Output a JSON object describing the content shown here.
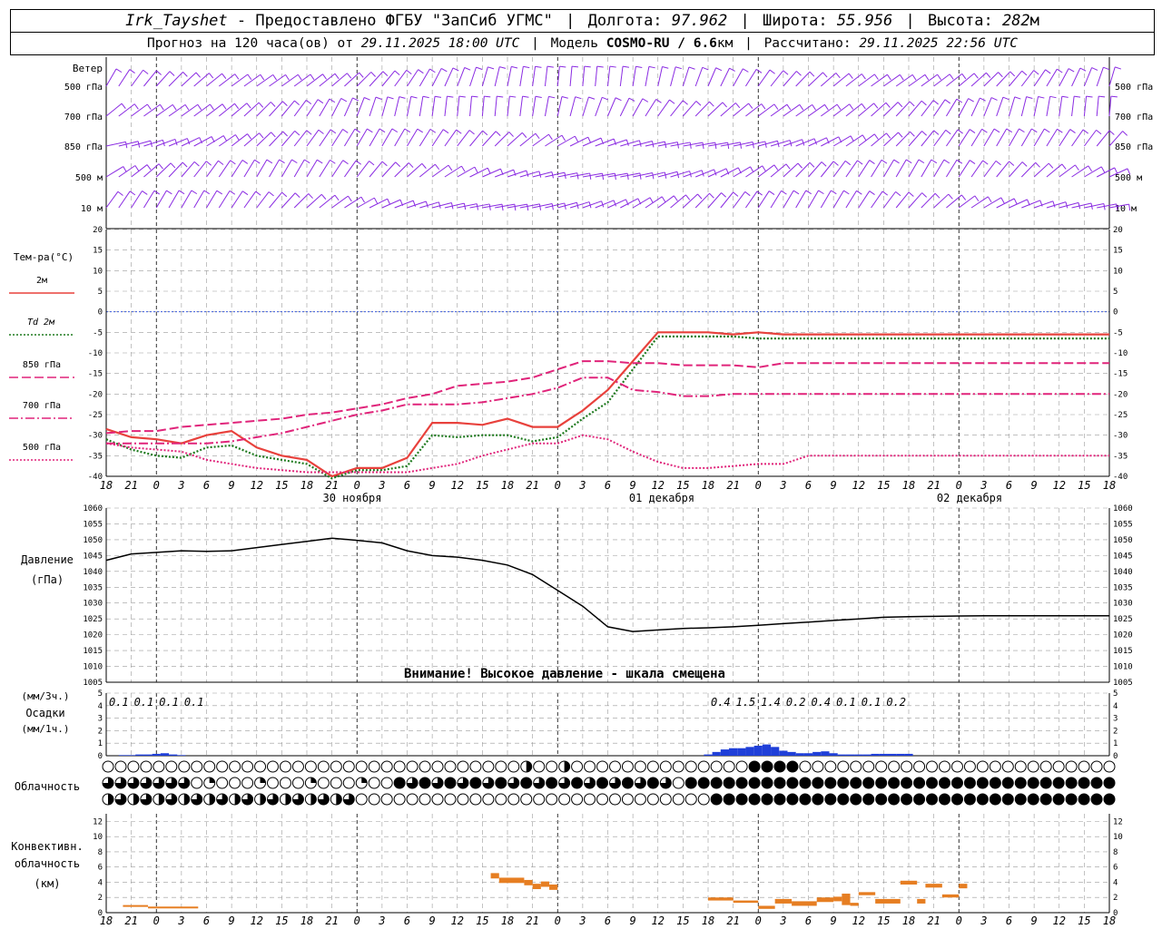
{
  "header": {
    "station": "Irk_Tayshet",
    "provider": "Предоставлено ФГБУ \"ЗапСиб УГМС\"",
    "lon_label": "Долгота:",
    "lon": "97.962",
    "lat_label": "Широта:",
    "lat": "55.956",
    "alt_label": "Высота:",
    "alt": "282",
    "alt_unit": "м",
    "forecast_label": "Прогноз на 120 часа(ов) от",
    "forecast_from": "29.11.2025 18:00 UTC",
    "model_label": "Модель",
    "model": "COSMO-RU / 6.6",
    "model_unit": "км",
    "calc_label": "Рассчитано:",
    "calc_time": "29.11.2025 22:56 UTC"
  },
  "colors": {
    "wind": "#8a2be2",
    "t2m": "#e8413c",
    "td2m": "#1e7a1e",
    "upper": "#e0247a",
    "pressure": "#000000",
    "precip": "#1f3fd8",
    "conv": "#e67e22",
    "zero_line": "#3b5bdb",
    "grid": "#9a9a9a"
  },
  "chart_data": [
    {
      "type": "wind_barbs",
      "panel_title": "Ветер",
      "levels": [
        "500 гПа",
        "700 гПа",
        "850 гПа",
        "500 м",
        "10 м"
      ]
    },
    {
      "type": "line",
      "panel_title": "Тем-ра(°C)",
      "ylim": [
        -40,
        20
      ],
      "yticks": [
        20,
        15,
        10,
        5,
        0,
        -5,
        -10,
        -15,
        -20,
        -25,
        -30,
        -35,
        -40
      ],
      "x_hours": [
        0,
        3,
        6,
        9,
        12,
        15,
        18,
        21,
        24,
        27,
        30,
        33,
        36,
        39,
        42,
        45,
        48,
        51,
        54,
        57,
        60,
        63,
        66,
        69,
        72,
        75,
        78,
        81,
        84,
        87,
        90,
        93,
        96,
        99,
        102,
        105,
        108,
        111,
        114,
        117,
        120
      ],
      "x_tick_labels": [
        "18",
        "21",
        "0",
        "3",
        "6",
        "9",
        "12",
        "15",
        "18",
        "21",
        "0",
        "3",
        "6",
        "9",
        "12",
        "15",
        "18",
        "21",
        "0",
        "3",
        "6",
        "9",
        "12",
        "15",
        "18",
        "21",
        "0",
        "3",
        "6",
        "9",
        "12",
        "15",
        "18",
        "21",
        "0",
        "3",
        "6",
        "9",
        "12",
        "15",
        "18",
        "21",
        "0"
      ],
      "date_labels": [
        "30 ноября",
        "01 декабря",
        "02 декабря"
      ],
      "series": [
        {
          "name": "2м",
          "style": "solid",
          "values": [
            -28.5,
            -30.5,
            -31,
            -32,
            -30,
            -29,
            -33,
            -35,
            -36,
            -40,
            -38,
            -38,
            -35.5,
            -27,
            -27,
            -27.5,
            -26,
            -28,
            -28,
            -24,
            -19,
            -12,
            -5,
            -5,
            -5,
            -5.5,
            -5,
            -5.5,
            -5.5,
            -5.5,
            -5.5,
            -5.5,
            -5.5,
            -5.5,
            -5.5,
            -5.5,
            -5.5,
            -5.5,
            -5.5,
            -5.5,
            -5.5
          ]
        },
        {
          "name": "Td 2м",
          "style": "dotted",
          "values": [
            -31,
            -33.5,
            -35,
            -35.5,
            -33,
            -32.5,
            -35,
            -36,
            -37,
            -40.5,
            -38.5,
            -38.5,
            -37.5,
            -30,
            -30.5,
            -30,
            -30,
            -31.5,
            -30.5,
            -26,
            -22,
            -14,
            -6,
            -6,
            -6,
            -6,
            -6.5,
            -6.5,
            -6.5,
            -6.5,
            -6.5,
            -6.5,
            -6.5,
            -6.5,
            -6.5,
            -6.5,
            -6.5,
            -6.5,
            -6.5,
            -6.5,
            -6.5
          ]
        },
        {
          "name": "850 гПа",
          "style": "dash",
          "values": [
            -29.5,
            -29,
            -29,
            -28,
            -27.5,
            -27,
            -26.5,
            -26,
            -25,
            -24.5,
            -23.5,
            -22.5,
            -21,
            -20,
            -18,
            -17.5,
            -17,
            -16,
            -14,
            -12,
            -12,
            -12.5,
            -12.5,
            -13,
            -13,
            -13,
            -13.5,
            -12.5,
            -12.5,
            -12.5,
            -12.5,
            -12.5,
            -12.5,
            -12.5,
            -12.5,
            -12.5,
            -12.5,
            -12.5,
            -12.5,
            -12.5,
            -12.5
          ]
        },
        {
          "name": "700 гПа",
          "style": "dashdot",
          "values": [
            -32,
            -32,
            -32,
            -32,
            -32,
            -31.5,
            -30.5,
            -29.5,
            -28,
            -26.5,
            -25,
            -24,
            -22.5,
            -22.5,
            -22.5,
            -22,
            -21,
            -20,
            -18.5,
            -16,
            -16,
            -19,
            -19.5,
            -20.5,
            -20.5,
            -20,
            -20,
            -20,
            -20,
            -20,
            -20,
            -20,
            -20,
            -20,
            -20,
            -20,
            -20,
            -20,
            -20,
            -20,
            -20
          ]
        },
        {
          "name": "500 гПа",
          "style": "dotted",
          "values": [
            -32,
            -33,
            -33.5,
            -34,
            -36,
            -37,
            -38,
            -38.5,
            -39,
            -39,
            -39,
            -39,
            -39,
            -38,
            -37,
            -35,
            -33.5,
            -32,
            -32,
            -30,
            -31,
            -34,
            -36.5,
            -38,
            -38,
            -37.5,
            -37,
            -37,
            -35,
            -35,
            -35,
            -35,
            -35,
            -35,
            -35,
            -35,
            -35,
            -35,
            -35,
            -35,
            -35
          ]
        }
      ]
    },
    {
      "type": "line",
      "panel_title": "Давление",
      "unit": "(гПа)",
      "ylim": [
        1005,
        1060
      ],
      "yticks": [
        1060,
        1055,
        1050,
        1045,
        1040,
        1035,
        1030,
        1025,
        1020,
        1015,
        1010,
        1005
      ],
      "warning": "Внимание! Высокое давление - шкала смещена",
      "series": [
        {
          "name": "",
          "values": [
            1043.5,
            1045.5,
            1046,
            1046.5,
            1046.3,
            1046.5,
            1047.5,
            1048.5,
            1049.5,
            1050.5,
            1049.8,
            1049,
            1046.5,
            1045,
            1044.5,
            1043.5,
            1042,
            1039,
            1034,
            1029,
            1022.5,
            1021,
            1021.5,
            1022,
            1022.2,
            1022.5,
            1023,
            1023.5,
            1024,
            1024.5,
            1025,
            1025.5,
            1025.7,
            1025.8,
            1025.9,
            1026,
            1026,
            1026,
            1026,
            1026,
            1026
          ]
        }
      ]
    },
    {
      "type": "bar",
      "panel_title": "Осадки",
      "unit_3h": "(мм/3ч.)",
      "unit_1h": "(мм/1ч.)",
      "ylim": [
        0,
        5
      ],
      "yticks": [
        5,
        4,
        3,
        2,
        1,
        0
      ],
      "sums_3h": [
        {
          "hour": 1.5,
          "label": "0.1"
        },
        {
          "hour": 4.5,
          "label": "0.1"
        },
        {
          "hour": 7.5,
          "label": "0.1"
        },
        {
          "hour": 10.5,
          "label": "0.1"
        },
        {
          "hour": 73.5,
          "label": "0.4"
        },
        {
          "hour": 76.5,
          "label": "1.5"
        },
        {
          "hour": 79.5,
          "label": "1.4"
        },
        {
          "hour": 82.5,
          "label": "0.2"
        },
        {
          "hour": 85.5,
          "label": "0.4"
        },
        {
          "hour": 88.5,
          "label": "0.1"
        },
        {
          "hour": 91.5,
          "label": "0.1"
        },
        {
          "hour": 94.5,
          "label": "0.2"
        }
      ],
      "hourly": [
        {
          "hour": 2,
          "value": 0.05
        },
        {
          "hour": 3,
          "value": 0.05
        },
        {
          "hour": 4,
          "value": 0.1
        },
        {
          "hour": 5,
          "value": 0.1
        },
        {
          "hour": 6,
          "value": 0.15
        },
        {
          "hour": 7,
          "value": 0.2
        },
        {
          "hour": 8,
          "value": 0.1
        },
        {
          "hour": 9,
          "value": 0.05
        },
        {
          "hour": 72,
          "value": 0.1
        },
        {
          "hour": 73,
          "value": 0.3
        },
        {
          "hour": 74,
          "value": 0.5
        },
        {
          "hour": 75,
          "value": 0.6
        },
        {
          "hour": 76,
          "value": 0.6
        },
        {
          "hour": 77,
          "value": 0.7
        },
        {
          "hour": 78,
          "value": 0.8
        },
        {
          "hour": 79,
          "value": 0.9
        },
        {
          "hour": 80,
          "value": 0.7
        },
        {
          "hour": 81,
          "value": 0.4
        },
        {
          "hour": 82,
          "value": 0.3
        },
        {
          "hour": 83,
          "value": 0.2
        },
        {
          "hour": 84,
          "value": 0.2
        },
        {
          "hour": 85,
          "value": 0.3
        },
        {
          "hour": 86,
          "value": 0.35
        },
        {
          "hour": 87,
          "value": 0.2
        },
        {
          "hour": 88,
          "value": 0.1
        },
        {
          "hour": 89,
          "value": 0.1
        },
        {
          "hour": 90,
          "value": 0.1
        },
        {
          "hour": 91,
          "value": 0.1
        },
        {
          "hour": 92,
          "value": 0.15
        },
        {
          "hour": 93,
          "value": 0.15
        },
        {
          "hour": 94,
          "value": 0.15
        },
        {
          "hour": 95,
          "value": 0.15
        },
        {
          "hour": 96,
          "value": 0.15
        }
      ]
    },
    {
      "type": "symbols",
      "panel_title": "Облачность",
      "rows": 3,
      "note": "cloud fraction 0-4 per hour, rows: high, middle, low"
    },
    {
      "type": "bar",
      "panel_title": "Конвективн. облачность",
      "unit": "(км)",
      "ylim": [
        0,
        13
      ],
      "yticks": [
        12,
        10,
        8,
        6,
        4,
        2,
        0
      ],
      "segments": [
        {
          "start": 2,
          "end": 5,
          "base": 0.8,
          "top": 1.0
        },
        {
          "start": 5,
          "end": 11,
          "base": 0.6,
          "top": 0.8
        },
        {
          "start": 46,
          "end": 47,
          "base": 4.5,
          "top": 5.2
        },
        {
          "start": 47,
          "end": 50,
          "base": 3.9,
          "top": 4.6
        },
        {
          "start": 50,
          "end": 51,
          "base": 3.6,
          "top": 4.3
        },
        {
          "start": 51,
          "end": 52,
          "base": 3.1,
          "top": 3.8
        },
        {
          "start": 52,
          "end": 53,
          "base": 3.4,
          "top": 4.1
        },
        {
          "start": 53,
          "end": 54,
          "base": 3.0,
          "top": 3.7
        },
        {
          "start": 72,
          "end": 75,
          "base": 1.6,
          "top": 2.0
        },
        {
          "start": 75,
          "end": 78,
          "base": 1.3,
          "top": 1.6
        },
        {
          "start": 78,
          "end": 80,
          "base": 0.5,
          "top": 0.9
        },
        {
          "start": 80,
          "end": 82,
          "base": 1.2,
          "top": 1.8
        },
        {
          "start": 82,
          "end": 85,
          "base": 0.9,
          "top": 1.5
        },
        {
          "start": 85,
          "end": 87,
          "base": 1.4,
          "top": 2.0
        },
        {
          "start": 87,
          "end": 88,
          "base": 1.5,
          "top": 2.1
        },
        {
          "start": 88,
          "end": 89,
          "base": 1.0,
          "top": 2.5
        },
        {
          "start": 89,
          "end": 90,
          "base": 0.9,
          "top": 1.3
        },
        {
          "start": 90,
          "end": 92,
          "base": 2.3,
          "top": 2.7
        },
        {
          "start": 92,
          "end": 95,
          "base": 1.2,
          "top": 1.8
        },
        {
          "start": 95,
          "end": 97,
          "base": 3.7,
          "top": 4.2
        },
        {
          "start": 97,
          "end": 98,
          "base": 1.2,
          "top": 1.8
        },
        {
          "start": 98,
          "end": 100,
          "base": 3.3,
          "top": 3.8
        },
        {
          "start": 100,
          "end": 102,
          "base": 2.0,
          "top": 2.4
        },
        {
          "start": 102,
          "end": 103,
          "base": 3.2,
          "top": 3.8
        }
      ]
    }
  ]
}
